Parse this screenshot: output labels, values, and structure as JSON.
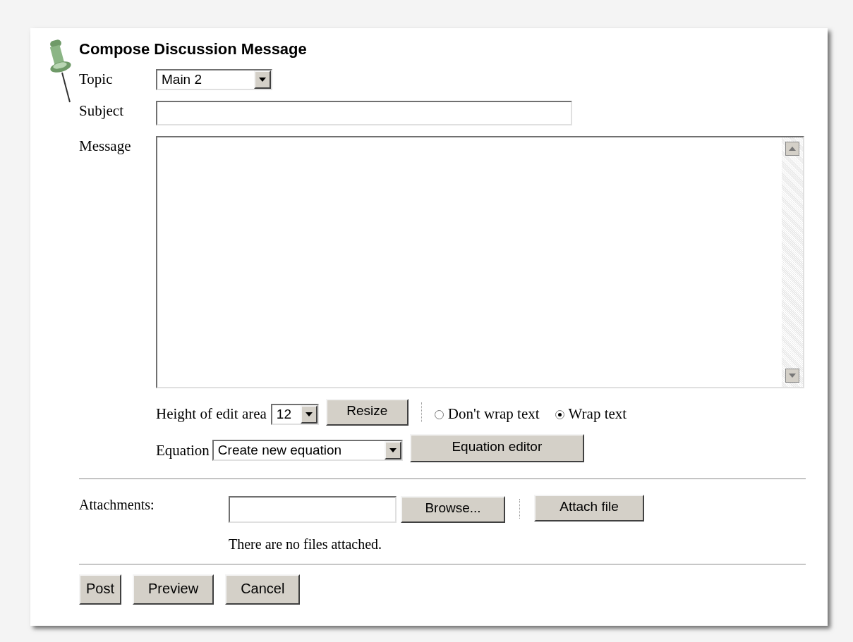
{
  "title": "Compose Discussion Message",
  "fields": [
    {
      "label": "Topic",
      "kind": "select",
      "value": "Main 2"
    },
    {
      "label": "Subject",
      "kind": "text"
    },
    {
      "label": "Message",
      "kind": "textarea"
    }
  ],
  "edit_area": {
    "label": "Height of edit area",
    "height_value": "12",
    "resize_button": "Resize",
    "wrap_options": [
      {
        "label": "Don't wrap text",
        "selected": false
      },
      {
        "label": "Wrap text",
        "selected": true
      }
    ]
  },
  "equation": {
    "label": "Equation",
    "value": "Create new equation",
    "button": "Equation editor"
  },
  "attachments": {
    "label": "Attachments:",
    "browse_button": "Browse...",
    "attach_button": "Attach file",
    "note": "There are no files attached."
  },
  "buttons": [
    "Post",
    "Preview",
    "Cancel"
  ]
}
